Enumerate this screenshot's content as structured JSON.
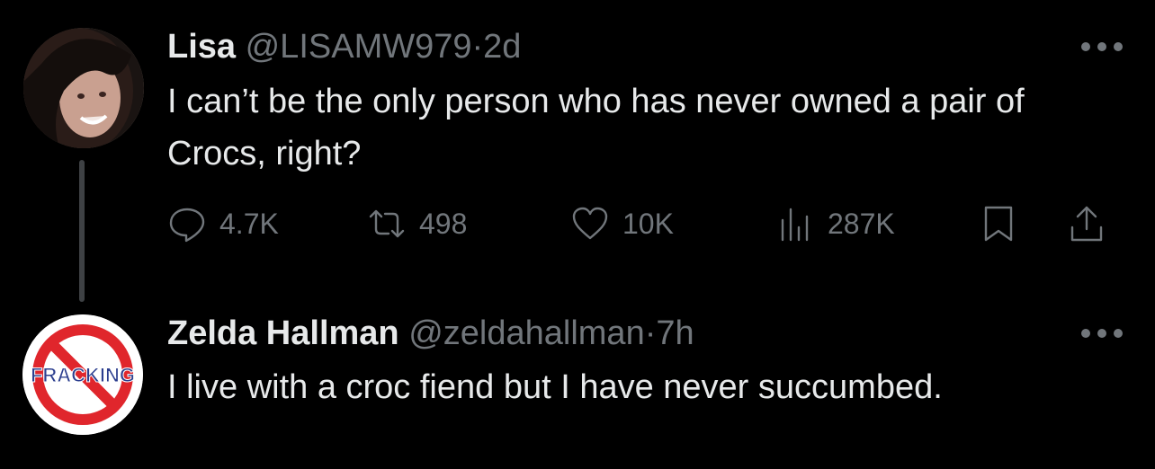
{
  "tweets": [
    {
      "name": "Lisa",
      "handle": "@LISAMW979",
      "separator": "·",
      "time": "2d",
      "text": "I can’t be the only person who has never owned a pair of Crocs, right?",
      "metrics": {
        "replies": "4.7K",
        "retweets": "498",
        "likes": "10K",
        "views": "287K"
      }
    },
    {
      "name": "Zelda Hallman",
      "handle": "@zeldahallman",
      "separator": "·",
      "time": "7h",
      "text": "I live with a croc fiend but I have never succumbed.",
      "avatar_text": "FRACKING"
    }
  ],
  "colors": {
    "background": "#000000",
    "text": "#e7e9ea",
    "muted": "#71767b",
    "no_sign_red": "#e0262c",
    "fracking_blue": "#2c3f8f"
  }
}
